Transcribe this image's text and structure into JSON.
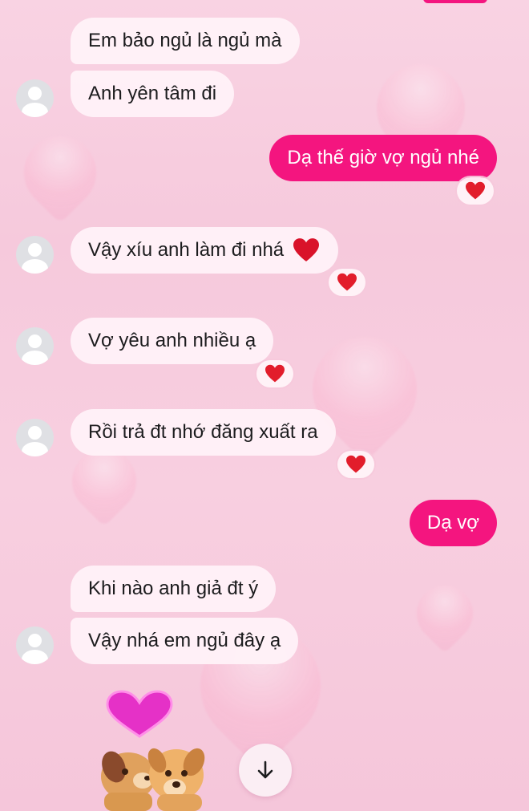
{
  "messages": [
    {
      "text": "Em bảo ngủ là ngủ mà",
      "side": "in"
    },
    {
      "text": "Anh yên tâm đi",
      "side": "in"
    },
    {
      "text": "Dạ thế giờ vợ ngủ nhé",
      "side": "out",
      "reaction": "red-heart"
    },
    {
      "text": "Vậy xíu anh làm đi nhá",
      "side": "in",
      "reaction": "red-heart",
      "inline_emoji": "red-heart"
    },
    {
      "text": "Vợ yêu anh nhiều ạ",
      "side": "in",
      "reaction": "red-heart"
    },
    {
      "text": "Rồi trả đt nhớ đăng xuất ra",
      "side": "in",
      "reaction": "red-heart"
    },
    {
      "text": "Dạ vợ",
      "side": "out"
    },
    {
      "text": "Khi nào anh giả đt ý",
      "side": "in"
    },
    {
      "text": "Vậy nhá em ngủ đây ạ",
      "side": "in"
    }
  ],
  "colors": {
    "outgoing_bubble": "#f4157f",
    "incoming_bubble": "#fff3f8",
    "reaction_heart": "#e21d2b",
    "background": "#f8cfe0"
  },
  "icons": {
    "avatar": "default-user-avatar-icon",
    "reaction": "red-heart-icon",
    "scroll": "arrow-down-icon",
    "sticker": "puppies-kissing-heart-sticker"
  }
}
